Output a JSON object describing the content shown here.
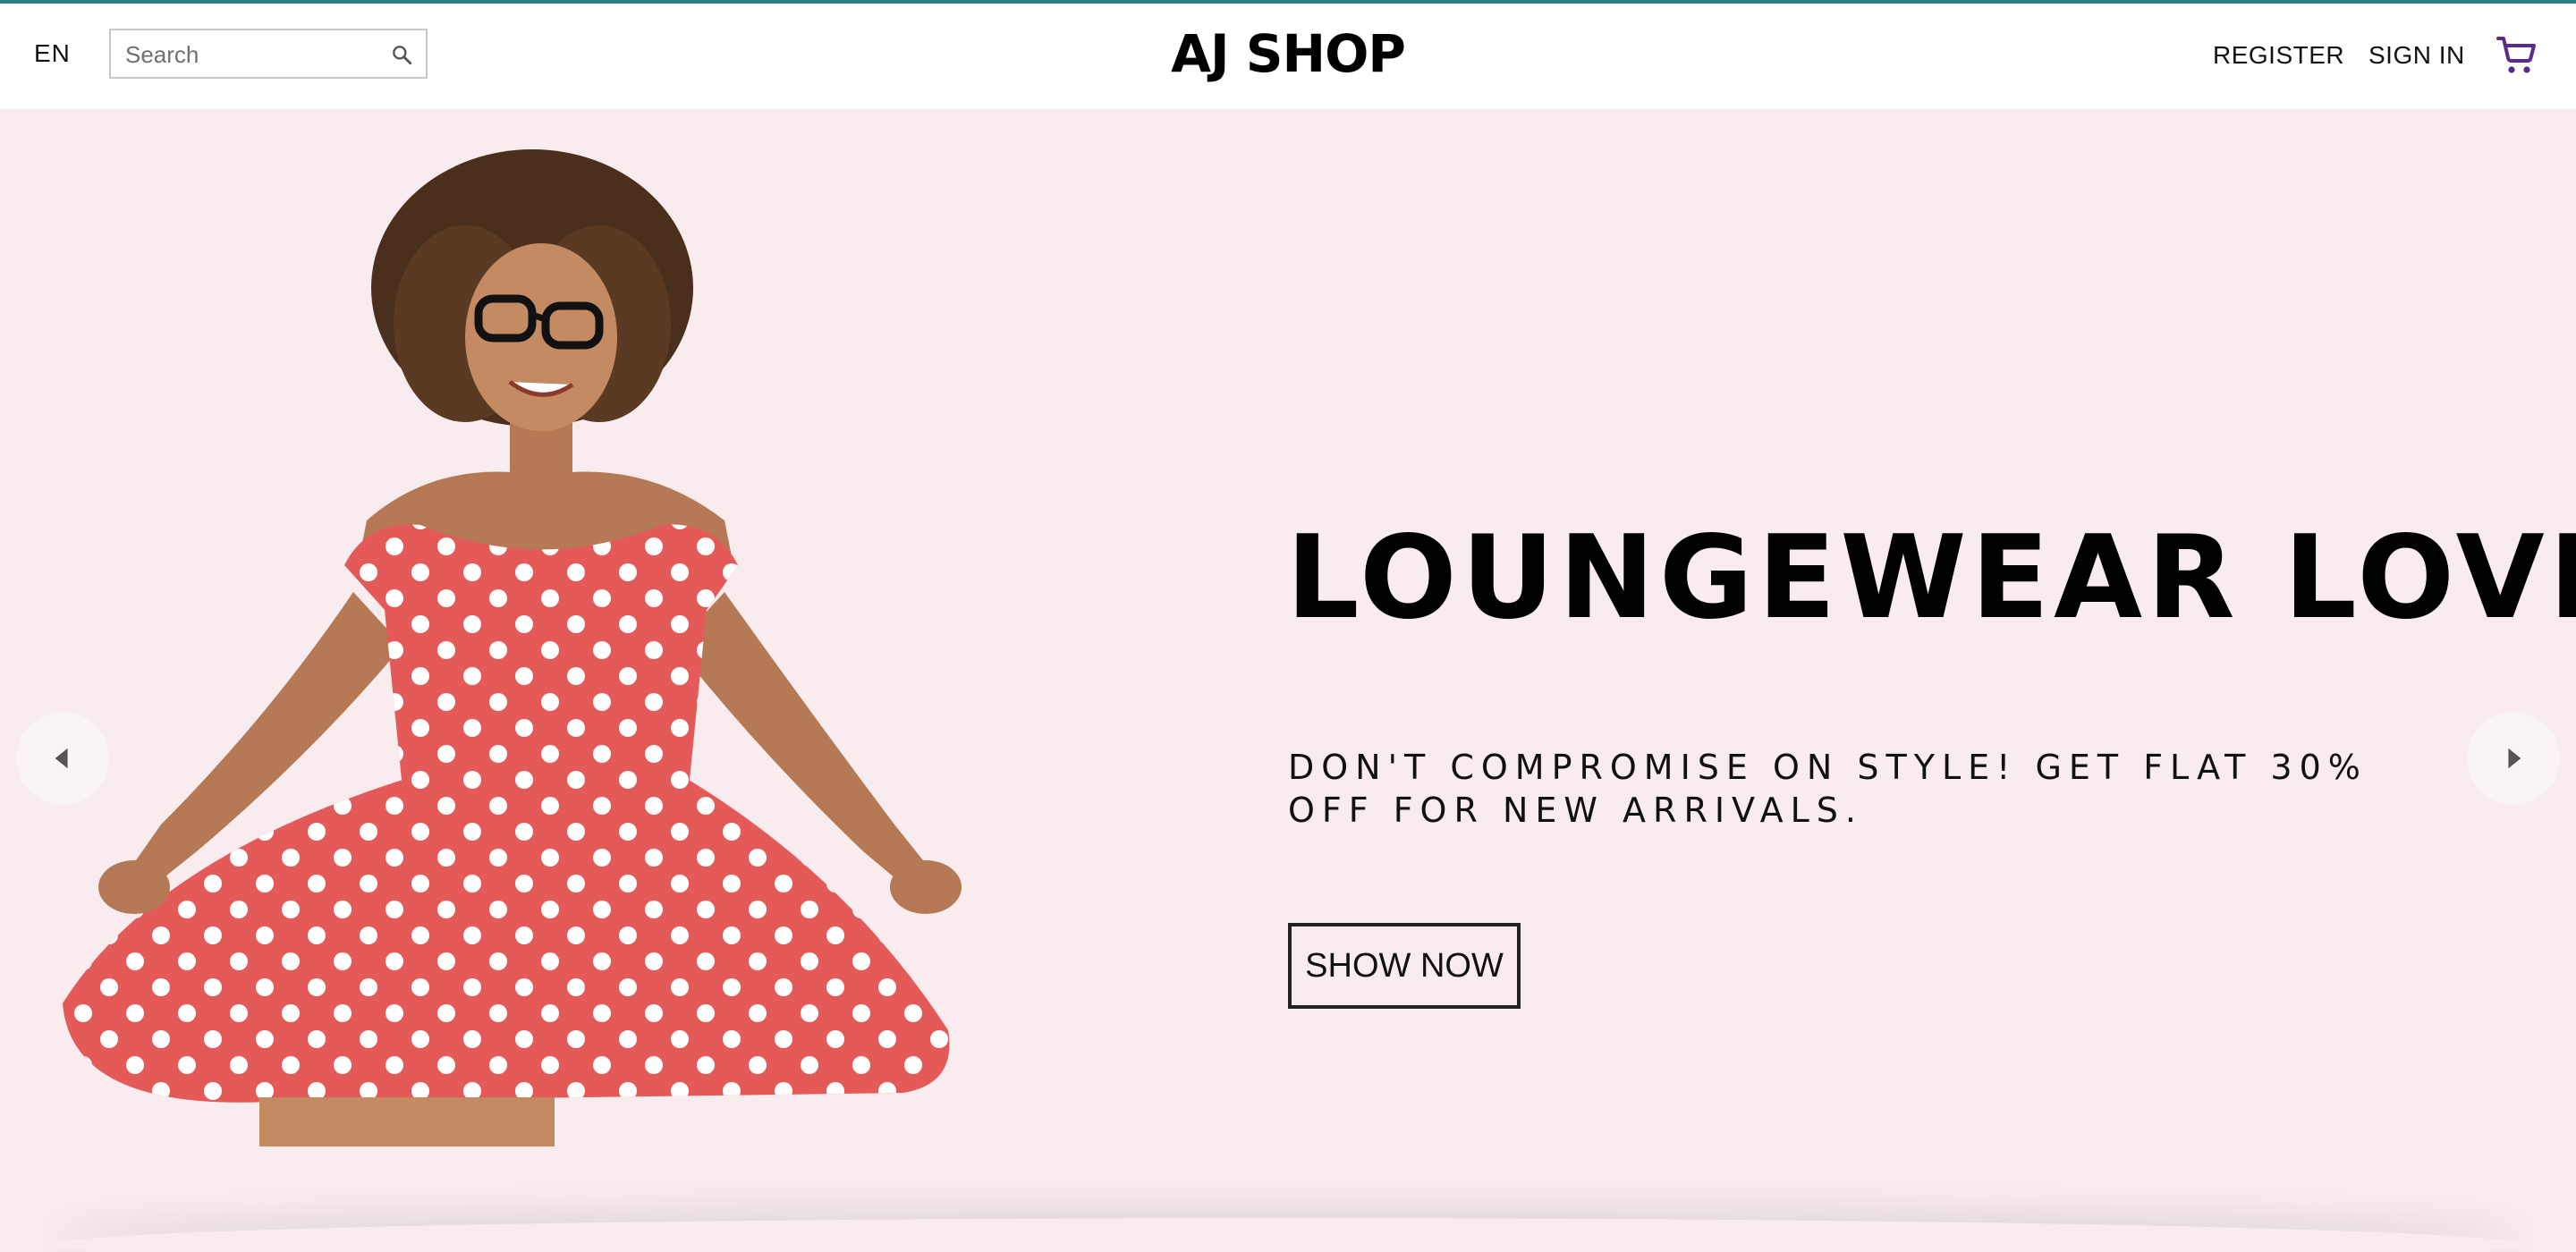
{
  "header": {
    "language": "EN",
    "search": {
      "placeholder": "Search",
      "value": ""
    },
    "brand": "AJ SHOP",
    "register_label": "REGISTER",
    "signin_label": "SIGN IN",
    "icons": {
      "search": "search-icon",
      "cart": "cart-icon"
    },
    "colors": {
      "top_border": "#2f7f86",
      "cart": "#5b2a8a"
    }
  },
  "hero": {
    "headline": "LOUNGEWEAR LOVE",
    "subtitle": "DON'T COMPROMISE ON STYLE! GET FLAT 30% OFF FOR NEW ARRIVALS.",
    "cta_label": "SHOW NOW",
    "background": "#f8ecef",
    "image": "woman-polka-dot-dress",
    "icons": {
      "prev": "arrow-left-icon",
      "next": "arrow-right-icon"
    }
  }
}
